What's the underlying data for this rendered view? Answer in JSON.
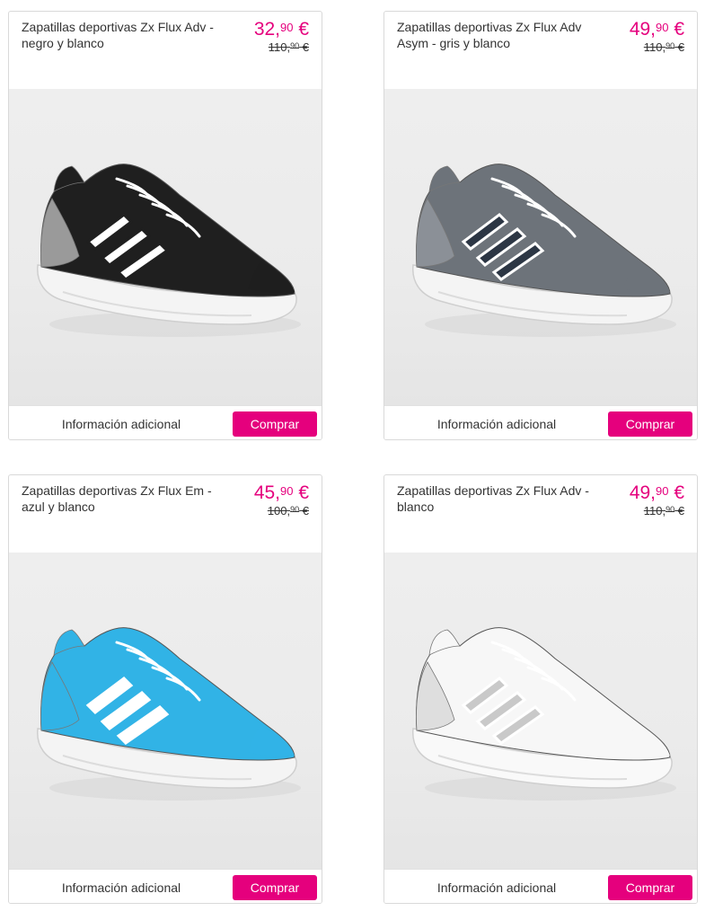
{
  "products": [
    {
      "title": "Zapatillas deportivas Zx Flux Adv - negro y blanco",
      "price_int": "32,",
      "price_dec": "90",
      "price_currency": " €",
      "old_int": "110,",
      "old_dec": "90",
      "old_currency": " €",
      "info_label": "Información adicional",
      "buy_label": "Comprar",
      "colors": {
        "upper": "#1f1f1f",
        "stripe": "#ffffff",
        "stripe_outline": "#1f1f1f",
        "heel": "#9a9a9a",
        "sole": "#f4f4f4"
      }
    },
    {
      "title": "Zapatillas deportivas Zx Flux Adv Asym - gris y blanco",
      "price_int": "49,",
      "price_dec": "90",
      "price_currency": " €",
      "old_int": "110,",
      "old_dec": "90",
      "old_currency": " €",
      "info_label": "Información adicional",
      "buy_label": "Comprar",
      "colors": {
        "upper": "#6d737a",
        "stripe": "#2c3644",
        "stripe_outline": "#ffffff",
        "heel": "#8b9097",
        "sole": "#f4f4f4"
      }
    },
    {
      "title": "Zapatillas deportivas Zx Flux Em - azul y blanco",
      "price_int": "45,",
      "price_dec": "90",
      "price_currency": " €",
      "old_int": "100,",
      "old_dec": "90",
      "old_currency": " €",
      "info_label": "Información adicional",
      "buy_label": "Comprar",
      "colors": {
        "upper": "#31b3e6",
        "stripe": "#ffffff",
        "stripe_outline": "#ffffff",
        "heel": "#31b3e6",
        "sole": "#f4f4f4"
      }
    },
    {
      "title": "Zapatillas deportivas Zx Flux Adv - blanco",
      "price_int": "49,",
      "price_dec": "90",
      "price_currency": " €",
      "old_int": "110,",
      "old_dec": "90",
      "old_currency": " €",
      "info_label": "Información adicional",
      "buy_label": "Comprar",
      "colors": {
        "upper": "#f7f7f7",
        "stripe": "#c9c9c9",
        "stripe_outline": "#ffffff",
        "heel": "#dedede",
        "sole": "#f9f9f9"
      }
    }
  ],
  "accent_color": "#e5007d"
}
